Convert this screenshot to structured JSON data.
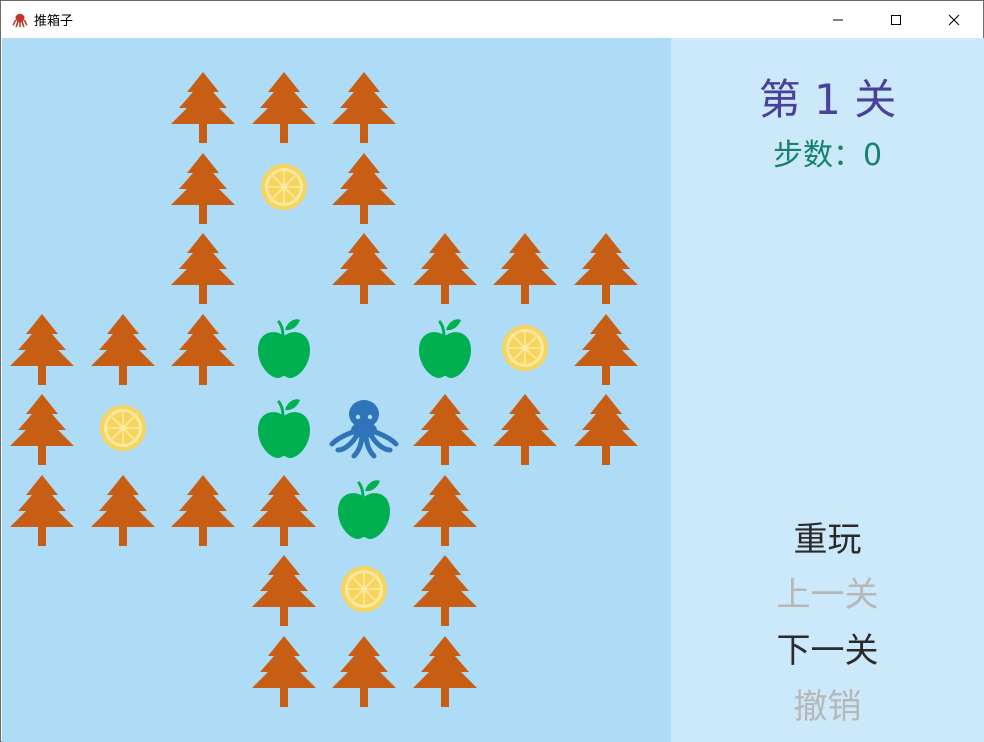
{
  "window": {
    "title": "推箱子",
    "app_icon": "octopus-icon",
    "controls": [
      "minimize-icon",
      "maximize-icon",
      "close-icon"
    ]
  },
  "colors": {
    "board_bg": "#aedcf7",
    "sidebar_bg": "#cce8fb",
    "tree": "#c85d14",
    "apple": "#00b050",
    "target": "#f7d45c",
    "player": "#2f73b8",
    "level_text": "#4b3f9a",
    "steps_text": "#178075"
  },
  "legend": {
    "tree": "tree-wall-icon",
    "apple": "apple-box-icon",
    "target": "lemon-target-icon",
    "player": "octopus-player-icon"
  },
  "level": {
    "title": "第 1 关",
    "steps_label": "步数：0",
    "steps": 0
  },
  "map": {
    "rows": [
      "  TTT   ",
      "  TLT   ",
      "  T TTTT",
      "TTTA ALT",
      "TL AOTTT",
      "TTTTAT  ",
      "   TLT  ",
      "   TTT  "
    ]
  },
  "menu": [
    {
      "id": "replay",
      "label": "重玩",
      "enabled": true
    },
    {
      "id": "prev-level",
      "label": "上一关",
      "enabled": false
    },
    {
      "id": "next-level",
      "label": "下一关",
      "enabled": true
    },
    {
      "id": "undo",
      "label": "撤销",
      "enabled": false
    }
  ]
}
